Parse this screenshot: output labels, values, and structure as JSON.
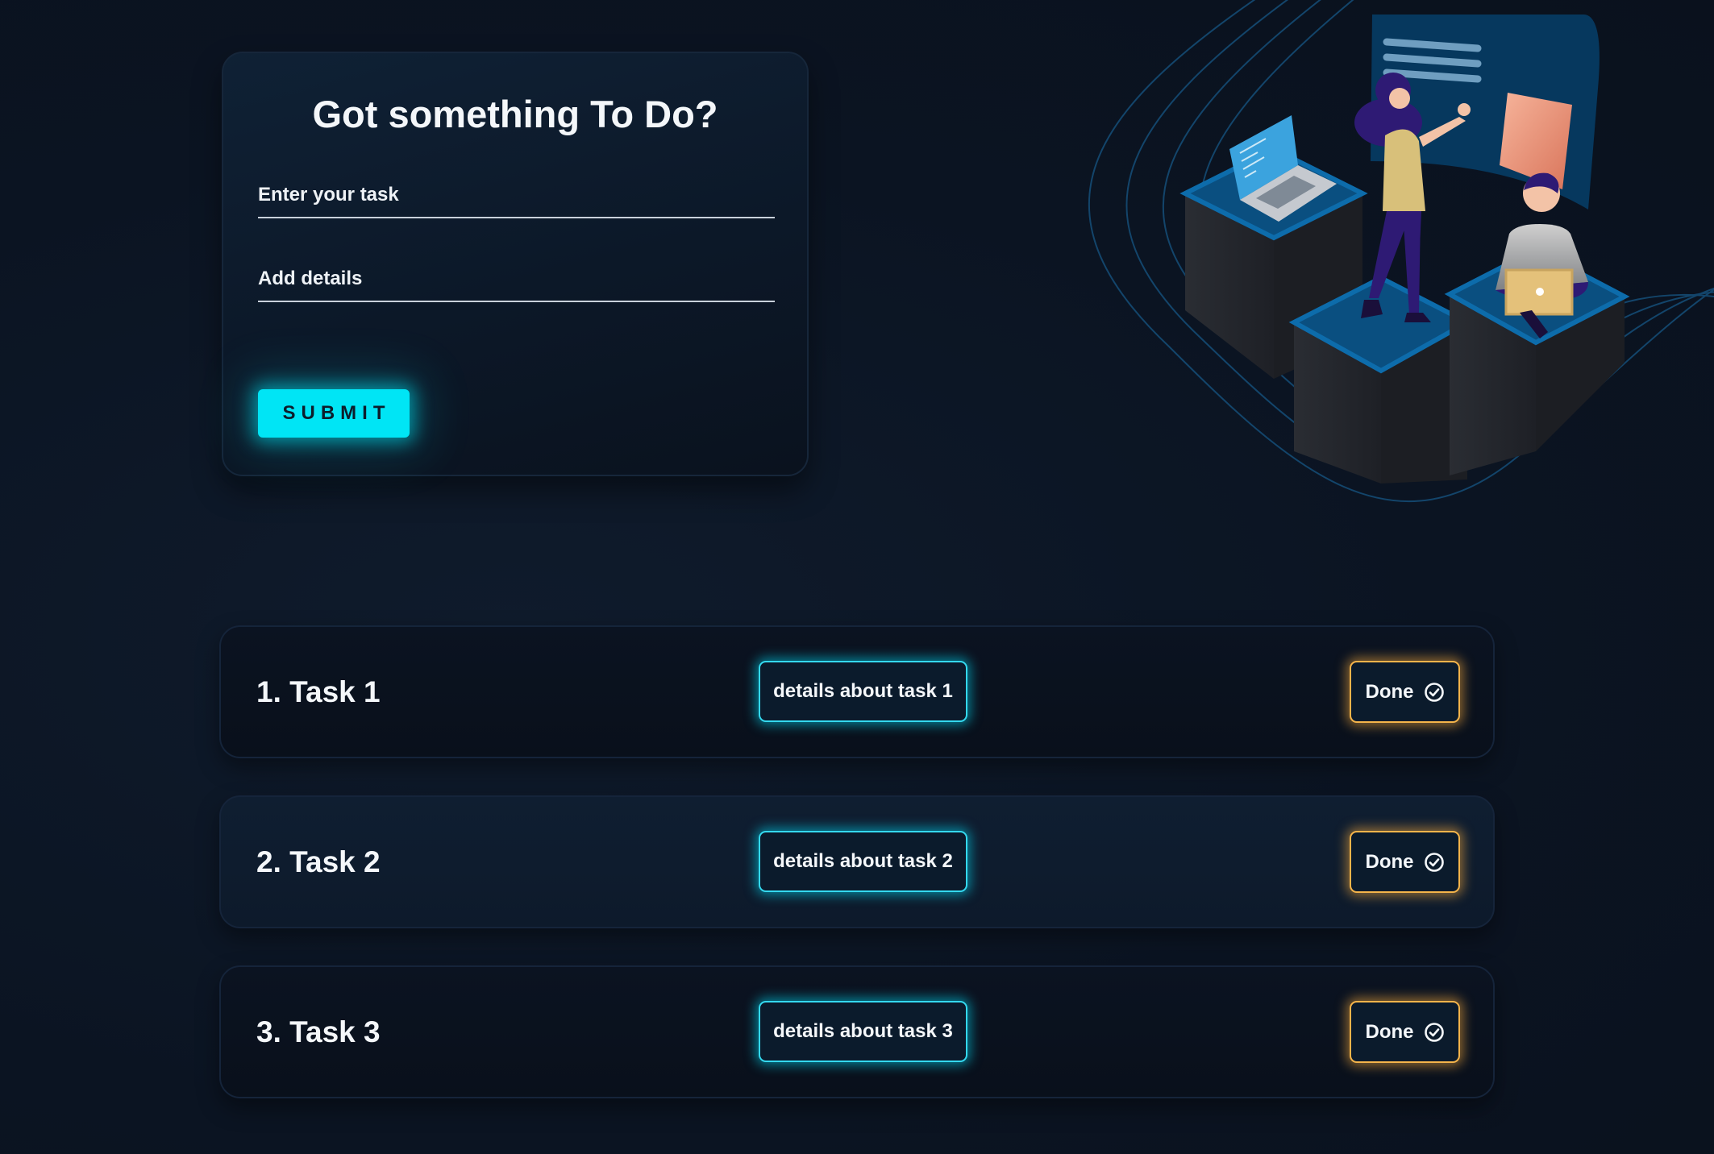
{
  "form": {
    "title": "Got something To Do?",
    "task_placeholder": "Enter your task",
    "task_value": "",
    "details_placeholder": "Add details",
    "details_value": "",
    "submit_label": "SUBMIT"
  },
  "tasks": [
    {
      "title": "1. Task 1",
      "details": "details about task 1",
      "done_label": "Done"
    },
    {
      "title": "2. Task 2",
      "details": "details about task 2",
      "done_label": "Done"
    },
    {
      "title": "3. Task 3",
      "details": "details about task 3",
      "done_label": "Done"
    }
  ],
  "icons": {
    "done": "check-circle-icon"
  },
  "colors": {
    "background": "#0c1523",
    "accent_cyan": "#00e5f5",
    "accent_amber": "#f5b44a",
    "card": "#0f2135"
  }
}
